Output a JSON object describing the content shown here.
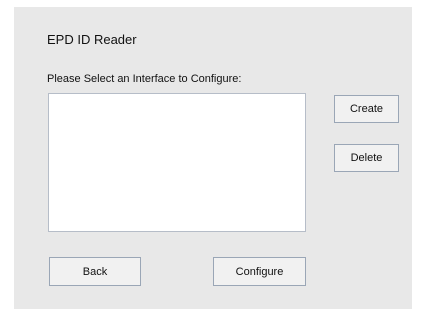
{
  "window": {
    "title": "EPD ID Reader"
  },
  "main": {
    "prompt": "Please Select an Interface to Configure:",
    "interfaces": []
  },
  "side_buttons": {
    "create_label": "Create",
    "delete_label": "Delete"
  },
  "footer": {
    "back_label": "Back",
    "configure_label": "Configure"
  },
  "colors": {
    "panel_background": "#e8e8e8",
    "button_border": "#9aa6b6",
    "list_background": "#ffffff"
  }
}
